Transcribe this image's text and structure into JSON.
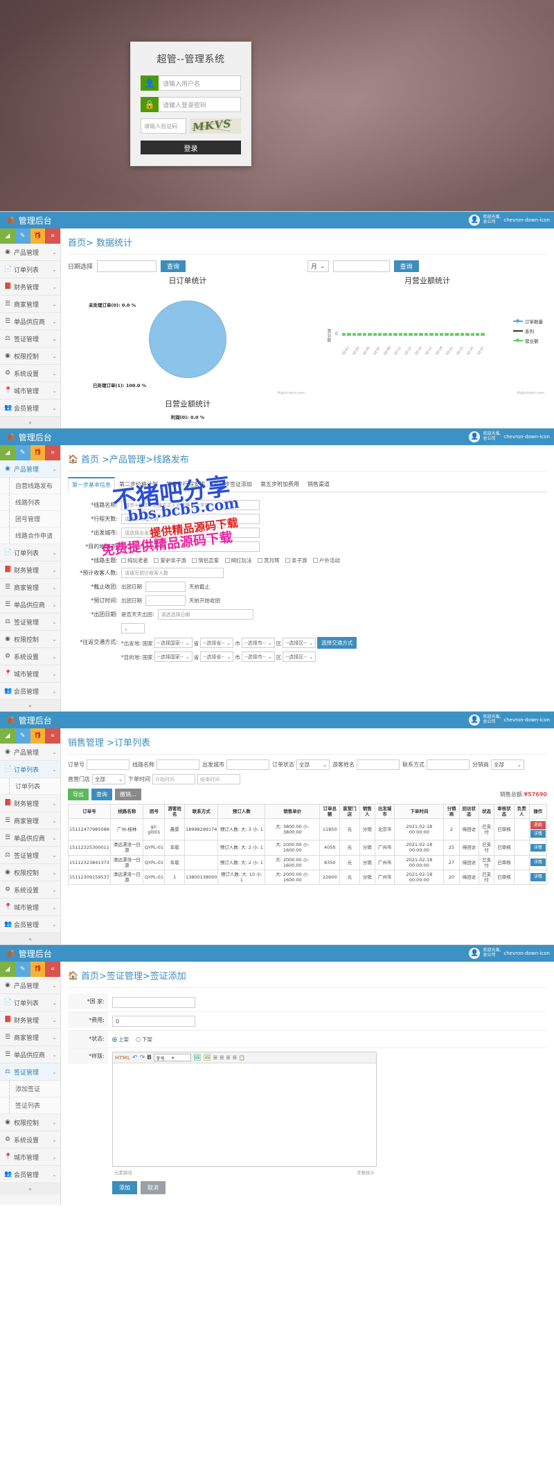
{
  "login": {
    "title": "超管--管理系统",
    "username_placeholder": "请输入用户名",
    "password_placeholder": "请输入登录密码",
    "captcha_placeholder": "请输入验证码",
    "captcha_text": "MKVS",
    "submit_label": "登录",
    "user_icon": "user-icon",
    "lock_icon": "lock-icon"
  },
  "topbar": {
    "title": "管理后台",
    "leaf_icon": "leaf-icon",
    "user_line1": "欢迎光临,",
    "user_line2": "总公司",
    "avatar_icon": "avatar-icon",
    "caret_icon": "chevron-down-icon"
  },
  "quick_tools": [
    {
      "name": "chart-tool",
      "glyph": "◢"
    },
    {
      "name": "edit-tool",
      "glyph": "✎"
    },
    {
      "name": "gift-tool",
      "glyph": "🎁"
    },
    {
      "name": "share-tool",
      "glyph": "∝"
    }
  ],
  "menu": [
    {
      "label": "产品管理",
      "icon": "box-icon",
      "caret": "⌄"
    },
    {
      "label": "订单列表",
      "icon": "file-icon",
      "caret": "⌄"
    },
    {
      "label": "财务管理",
      "icon": "book-icon",
      "caret": "⌄"
    },
    {
      "label": "商家管理",
      "icon": "list-icon",
      "caret": "⌄"
    },
    {
      "label": "单品供应商",
      "icon": "list-icon",
      "caret": "⌄"
    },
    {
      "label": "签证管理",
      "icon": "stamp-icon",
      "caret": "⌄"
    },
    {
      "label": "权限控制",
      "icon": "shield-icon",
      "caret": "⌄"
    },
    {
      "label": "系统设置",
      "icon": "gear-icon",
      "caret": "⌄"
    },
    {
      "label": "城市管理",
      "icon": "pin-icon",
      "caret": "⌄"
    },
    {
      "label": "会员管理",
      "icon": "users-icon",
      "caret": "⌄"
    }
  ],
  "collapse_label": "«",
  "panel_stats": {
    "breadcrumb": "首页> 数据统计",
    "date_label": "日期选择",
    "query_label": "查询",
    "month_select": "月",
    "month_caret": "⌄",
    "month_query_label": "查询",
    "left_chart": {
      "title": "日订单统计",
      "type": "pie",
      "credit": "Highcharts.com"
    },
    "right_chart": {
      "title": "月营业额统计",
      "credit": "Highcharts.com"
    },
    "bottom_title": "日营业额统计",
    "bottom_label": "利润(0): 0.0 %"
  },
  "chart_data": [
    {
      "type": "pie",
      "title": "日订单统计",
      "labels": [
        "未处理订单(0)",
        "已处理订单(1)"
      ],
      "values": [
        0.0,
        100.0
      ],
      "value_labels": [
        "未处理订单(0): 0.0 %",
        "已处理订单(1): 100.0 %"
      ],
      "colors": [
        "#8bc4e8",
        "#8bc4e8"
      ],
      "legend_position": "none"
    },
    {
      "type": "line",
      "title": "月营业额统计",
      "xlabel": "",
      "ylabel": "营业额",
      "ylim": [
        0,
        0
      ],
      "yticks": [
        "0"
      ],
      "categories": [
        "02-01",
        "02-02",
        "02-03",
        "02-04",
        "02-05",
        "02-06",
        "02-07",
        "02-08",
        "02-09",
        "02-10",
        "02-11",
        "02-12",
        "02-13",
        "02-14",
        "02-15",
        "02-16",
        "02-17",
        "02-18",
        "02-19",
        "02-20",
        "02-21",
        "02-22",
        "02-23",
        "02-24",
        "02-25",
        "02-26",
        "02-27",
        "02-28"
      ],
      "series": [
        {
          "name": "订单数量",
          "color": "#5aa9dd",
          "values": [
            0,
            0,
            0,
            0,
            0,
            0,
            0,
            0,
            0,
            0,
            0,
            0,
            0,
            0,
            0,
            0,
            0,
            0,
            0,
            0,
            0,
            0,
            0,
            0,
            0,
            0,
            0,
            0
          ]
        },
        {
          "name": "系列",
          "color": "#333333",
          "values": [
            0,
            0,
            0,
            0,
            0,
            0,
            0,
            0,
            0,
            0,
            0,
            0,
            0,
            0,
            0,
            0,
            0,
            0,
            0,
            0,
            0,
            0,
            0,
            0,
            0,
            0,
            0,
            0
          ]
        },
        {
          "name": "营业额",
          "color": "#5cd65c",
          "values": [
            0,
            0,
            0,
            0,
            0,
            0,
            0,
            0,
            0,
            0,
            0,
            0,
            0,
            0,
            0,
            0,
            0,
            0,
            0,
            0,
            0,
            0,
            0,
            0,
            0,
            0,
            0,
            0
          ]
        }
      ],
      "legend_position": "right",
      "grid": false
    },
    {
      "type": "pie",
      "title": "日营业额统计",
      "labels": [
        "利润(0)"
      ],
      "values": [
        0.0
      ],
      "value_labels": [
        "利润(0): 0.0 %"
      ],
      "colors": [
        "#8bc4e8"
      ]
    }
  ],
  "panel_route": {
    "breadcrumb": "首页 >产品管理>线路发布",
    "home_icon": "home-icon",
    "submenu": [
      "自营线路发布",
      "线路列表",
      "团号管理",
      "线路合作申请"
    ],
    "tabs": [
      "第一步基本信息",
      "第二步价格计划",
      "第三步行程安排",
      "第四步签证添加",
      "第五步附加费用",
      "销售渠道"
    ],
    "active_tab_index": 0,
    "fields": [
      {
        "label": "*线路名称:",
        "value": "",
        "placeholder": "城市+景点+交通方式+天数等多个字符"
      },
      {
        "label": "*行程天数:",
        "value": "",
        "placeholder": "请填写行程天数"
      },
      {
        "label": "*出发城市:",
        "value": "",
        "placeholder": "请选择出发城市"
      },
      {
        "label": "*目的地城市:",
        "value": "",
        "placeholder": "请选择目的地城市"
      },
      {
        "label": "*线路主题:",
        "value": "",
        "placeholder": ""
      },
      {
        "label": "*预计收客人数:",
        "value": "",
        "placeholder": "请填写预计收客人数"
      },
      {
        "label": "*截止收团:",
        "value": "出团日期",
        "placeholder": "天前截止"
      },
      {
        "label": "*预订时间:",
        "value": "出团日期",
        "placeholder": "天前开始收团"
      },
      {
        "label": "*出团日期:",
        "value": "是否天天出团:",
        "placeholder": "请选选择日期"
      },
      {
        "label": "*往返交通方式:",
        "value": "",
        "placeholder": ""
      }
    ],
    "theme_options": [
      "纯玩老者",
      "爱驴亲子游",
      "情侣恋爱",
      "网红玩法",
      "赏月辉",
      "亲子游",
      "户外活动"
    ],
    "transport_out_label": "*出发地:",
    "transport_back_label": "*目的地:",
    "geo_labels": [
      "国家",
      "省",
      "市",
      "区"
    ],
    "geo_placeholder": "--选择国家--",
    "geo_placeholder_province": "--选择省--",
    "geo_placeholder_city": "--选择市--",
    "geo_placeholder_district": "--选择区--",
    "transport_button": "选择交通方式",
    "daily_departure_label": "是否天天出团:",
    "departure_date_placeholder": "请选选择日期",
    "watermarks": {
      "blue": "不猪吧分享",
      "domain": "bbs.bcb5.com",
      "red_small": "提供精品源码下载",
      "pink": "免费提供精品源码下载"
    }
  },
  "panel_orders": {
    "title": "销售管理 >订单列表",
    "submenu": [
      "订单列表"
    ],
    "search": [
      {
        "label": "订单号",
        "type": "input",
        "value": ""
      },
      {
        "label": "线路名称",
        "type": "input",
        "value": ""
      },
      {
        "label": "出发城市",
        "type": "input",
        "value": ""
      },
      {
        "label": "订单状态",
        "type": "select",
        "value": "全部"
      },
      {
        "label": "游客姓名",
        "type": "input",
        "value": ""
      },
      {
        "label": "联系方式",
        "type": "input",
        "value": ""
      },
      {
        "label": "分销商",
        "type": "select",
        "value": "全部"
      },
      {
        "label": "直营门店",
        "type": "select",
        "value": "全部"
      },
      {
        "label": "下单时间",
        "type": "input",
        "value": "",
        "placeholder": "开始时间"
      },
      {
        "label": "",
        "type": "input",
        "value": "",
        "placeholder": "结束时间"
      }
    ],
    "buttons": [
      {
        "label": "导出",
        "style": "green"
      },
      {
        "label": "查询",
        "style": "blue"
      },
      {
        "label": "撤销...",
        "style": "gray"
      }
    ],
    "sales_total_label": "销售总额:",
    "sales_total_value": "¥57690",
    "columns": [
      "订单号",
      "线路名称",
      "团号",
      "游客姓名",
      "联系方式",
      "预订人数",
      "销售单价",
      "订单总额",
      "直营门店",
      "销售人",
      "出发城市",
      "下单时间",
      "分销商",
      "回访状态",
      "状态",
      "审核状态",
      "负责人",
      "操作"
    ],
    "rows": [
      {
        "order_no": "15112477985088",
        "route": "广州-桂林",
        "group": "gz-gl001",
        "guest": "晨景",
        "phone": "18998299174",
        "persons": "预订人数: 大: 3 小: 1",
        "price": "大: 3800.00 小: 3800.00",
        "total": "11850",
        "store": "元",
        "seller": "分销",
        "city": "北京市",
        "order_time": "2021-02-18 00:00:00",
        "distributor": "2",
        "visit": "待回访",
        "status": "已支付",
        "audit": "已审核",
        "owner": "",
        "actions": [
          "退款",
          "详情"
        ]
      },
      {
        "order_no": "15112325300011",
        "route": "清远漂流一日游",
        "group": "QYPL-01",
        "guest": "年欹",
        "phone": "",
        "persons": "预订人数: 大: 2 小: 1",
        "price": "大: 2000.00 小: 1600.00",
        "total": "4050",
        "store": "元",
        "seller": "分销",
        "city": "广州市",
        "order_time": "2021-02-18 00:00:00",
        "distributor": "25",
        "visit": "待回访",
        "status": "已支付",
        "audit": "已审核",
        "owner": "",
        "actions": [
          "详情"
        ]
      },
      {
        "order_no": "15112323841373",
        "route": "清远漂流一日游",
        "group": "QYPL-01",
        "guest": "年欹",
        "phone": "",
        "persons": "预订人数: 大: 2 小: 1",
        "price": "大: 2000.00 小: 1600.00",
        "total": "8350",
        "store": "元",
        "seller": "分销",
        "city": "广州市",
        "order_time": "2021-02-18 00:00:00",
        "distributor": "27",
        "visit": "待回访",
        "status": "已支付",
        "audit": "已审核",
        "owner": "",
        "actions": [
          "详情"
        ]
      },
      {
        "order_no": "15112309159537",
        "route": "清远漂流一日游",
        "group": "QYPL-01",
        "guest": "1",
        "phone": "13800138000",
        "persons": "预订人数: 大: 10 小: 1",
        "price": "大: 2000.00 小: 1600.00",
        "total": "22600",
        "store": "元",
        "seller": "分销",
        "city": "广州市",
        "order_time": "2021-02-18 00:00:00",
        "distributor": "20",
        "visit": "待回访",
        "status": "已支付",
        "audit": "已审核",
        "owner": "",
        "actions": [
          "详情"
        ]
      }
    ]
  },
  "panel_visa": {
    "breadcrumb": "首页>签证管理>签证添加",
    "home_icon": "home-icon",
    "submenu": [
      "添加签证",
      "签证列表"
    ],
    "fields": [
      {
        "label": "*国 家:",
        "value": "",
        "type": "input"
      },
      {
        "label": "*费用:",
        "value": "0",
        "type": "input"
      },
      {
        "label": "*状态:",
        "value": "",
        "type": "radio",
        "options": [
          {
            "label": "上架",
            "checked": true
          },
          {
            "label": "下架",
            "checked": false
          }
        ]
      },
      {
        "label": "*样版:",
        "value": "",
        "type": "editor"
      }
    ],
    "editor": {
      "font_label": "字号",
      "bold_label": "B",
      "html_label": "HTML",
      "undo_icon": "undo-icon",
      "redo_icon": "redo-icon",
      "image_icon": "image-icon",
      "caret_icon": "chevron-down-icon",
      "footer_left": "元素路径",
      "footer_right": "字数统计"
    },
    "buttons": [
      {
        "label": "添加",
        "style": "blue"
      },
      {
        "label": "取消",
        "style": "gray"
      }
    ]
  }
}
